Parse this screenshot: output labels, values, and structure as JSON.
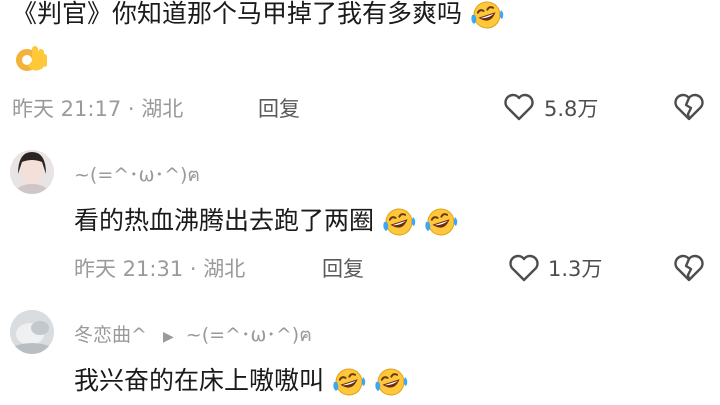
{
  "comments": [
    {
      "text_line1": "《判官》你知道那个马甲掉了我有多爽吗",
      "meta": "昨天 21:17 · 湖北",
      "reply_label": "回复",
      "likes": "5.8万",
      "emojis": [
        "laugh-cry-emoji",
        "ok-hand-emoji"
      ]
    },
    {
      "username": "~(=^･ω･^)ฅ",
      "text": "看的热血沸腾出去跑了两圈",
      "meta": "昨天 21:31 · 湖北",
      "reply_label": "回复",
      "likes": "1.3万",
      "emojis": [
        "laugh-cry-emoji",
        "laugh-cry-emoji"
      ]
    },
    {
      "username": "冬恋曲^",
      "reply_to": "~(=^･ω･^)ฅ",
      "text": "我兴奋的在床上嗷嗷叫",
      "emojis": [
        "laugh-cry-emoji",
        "laugh-cry-emoji"
      ]
    }
  ],
  "colors": {
    "meta_gray": "#9a9a9a",
    "text_dark": "#1a1a1a",
    "emoji_yellow": "#ffc83a",
    "tear_blue": "#3fa7f0"
  }
}
